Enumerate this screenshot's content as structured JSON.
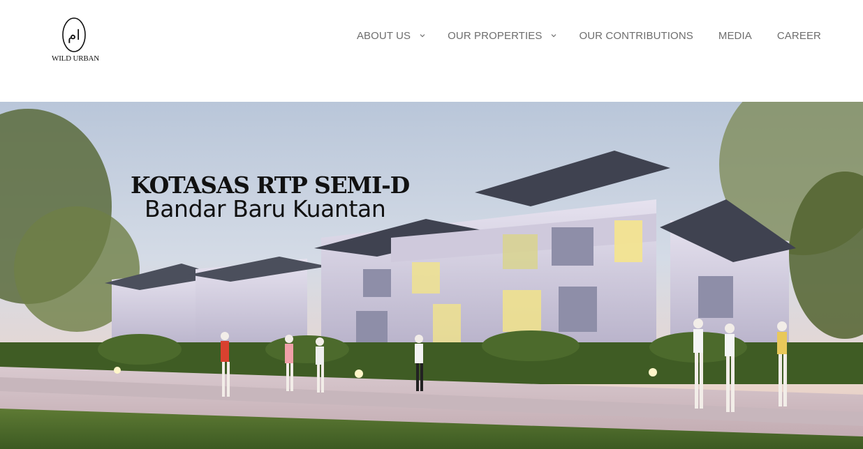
{
  "brand": {
    "name": "WILD URBAN",
    "mark_glyph": "ام"
  },
  "nav": {
    "items": [
      {
        "label": "ABOUT US",
        "has_submenu": true
      },
      {
        "label": "OUR PROPERTIES",
        "has_submenu": true
      },
      {
        "label": "OUR CONTRIBUTIONS",
        "has_submenu": false
      },
      {
        "label": "MEDIA",
        "has_submenu": false
      },
      {
        "label": "CAREER",
        "has_submenu": false
      }
    ]
  },
  "hero": {
    "title": "KOTASAS RTP SEMI-D",
    "subtitle": "Bandar Baru Kuantan",
    "image": "architectural rendering of semi-detached houses with joggers on a park path"
  },
  "colors": {
    "nav_text": "#6e6e6e",
    "heading": "#111111",
    "background": "#ffffff"
  }
}
